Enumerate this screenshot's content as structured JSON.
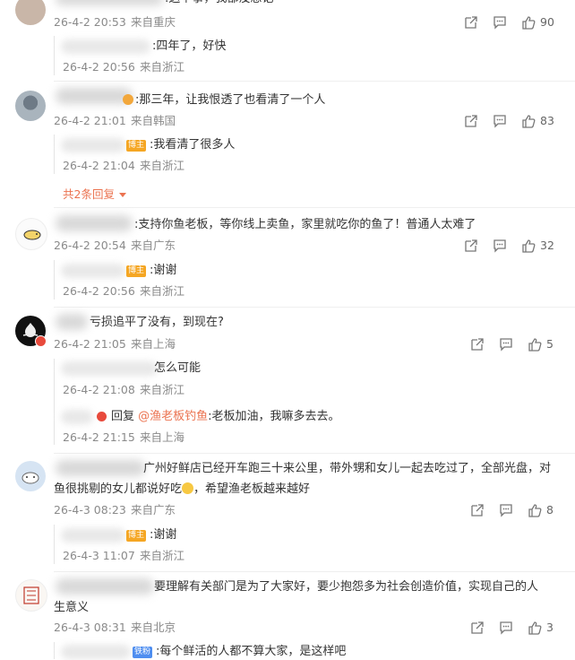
{
  "colors": {
    "accent": "#eb7350",
    "meta": "#8a8a8a",
    "badge": "#f5a623"
  },
  "comments": [
    {
      "text": ":这个事，我都没想记",
      "time": "26-4-2 20:53",
      "location": "来自重庆",
      "likes": "90",
      "replies": [
        {
          "text": ":四年了，好快",
          "time": "26-4-2 20:56",
          "location": "来自浙江"
        }
      ]
    },
    {
      "text": ":那三年，让我恨透了也看清了一个人",
      "time": "26-4-2 21:01",
      "location": "来自韩国",
      "likes": "83",
      "replies": [
        {
          "badge": "博主",
          "text": ":我看清了很多人",
          "time": "26-4-2 21:04",
          "location": "来自浙江"
        }
      ],
      "more_replies": "共2条回复"
    },
    {
      "text": ":支持你鱼老板，等你线上卖鱼，家里就吃你的鱼了！普通人太难了",
      "time": "26-4-2 20:54",
      "location": "来自广东",
      "likes": "32",
      "replies": [
        {
          "badge": "博主",
          "text": ":谢谢",
          "time": "26-4-2 20:56",
          "location": "来自浙江"
        }
      ]
    },
    {
      "text": "亏损追平了没有，到现在?",
      "time": "26-4-2 21:05",
      "location": "来自上海",
      "likes": "5",
      "replies": [
        {
          "text": "怎么可能",
          "time": "26-4-2 21:08",
          "location": "来自浙江"
        },
        {
          "prefix": "回复 ",
          "mention": "@渔老板钓鱼",
          "text": ":老板加油，我嘛多去去。",
          "time": "26-4-2 21:15",
          "location": "来自上海"
        }
      ]
    },
    {
      "text_line1": "广州好鲜店已经开车跑三十来公里，带外甥和女儿一起去吃过了，全部光盘，对",
      "text_line2a": "鱼很挑剔的女儿都说好吃",
      "text_line2b": "，希望渔老板越来越好",
      "time": "26-4-3 08:23",
      "location": "来自广东",
      "likes": "8",
      "replies": [
        {
          "badge": "博主",
          "text": ":谢谢",
          "time": "26-4-3 11:07",
          "location": "来自浙江"
        }
      ]
    },
    {
      "text_line1": "要理解有关部门是为了大家好，要少抱怨多为社会创造价值，实现自己的人",
      "text_line2": "生意义",
      "time": "26-4-3 08:31",
      "location": "来自北京",
      "likes": "3",
      "replies": [
        {
          "badge": "铁粉",
          "text": ":每个鲜活的人都不算大家，是这样吧"
        }
      ]
    }
  ],
  "icons": {
    "share": "share-icon",
    "comment": "comment-icon",
    "like": "like-icon"
  }
}
